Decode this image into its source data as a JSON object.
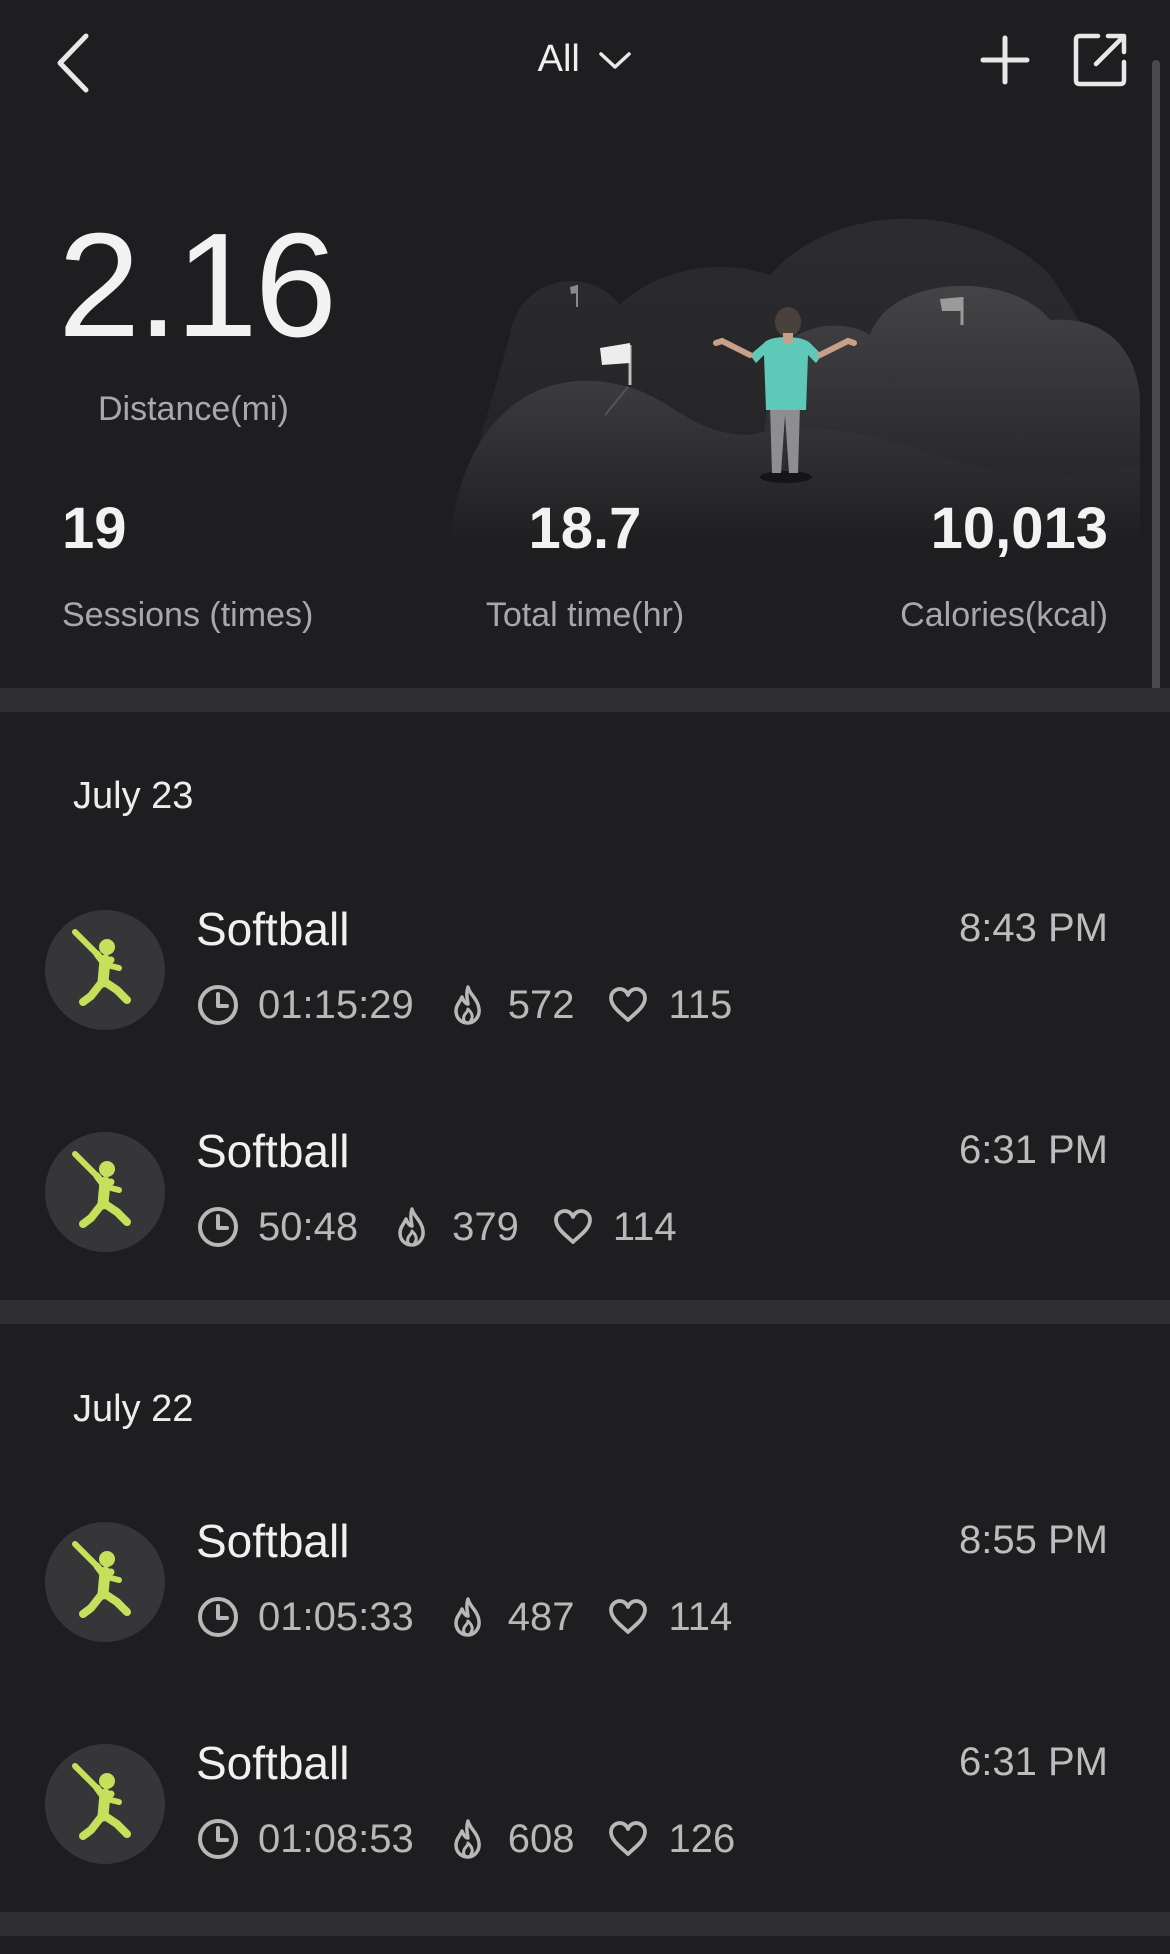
{
  "header": {
    "filter_label": "All"
  },
  "summary": {
    "distance_value": "2.16",
    "distance_label": "Distance(mi)",
    "sessions_value": "19",
    "sessions_label": "Sessions (times)",
    "time_value": "18.7",
    "time_label": "Total time(hr)",
    "calories_value": "10,013",
    "calories_label": "Calories(kcal)"
  },
  "colors": {
    "background": "#1e1e20",
    "divider": "#2f2f31",
    "accent_icon": "#c5e05a",
    "avatar_bg": "#363638",
    "person_shirt": "#5fc9b9"
  },
  "icons": {
    "back": "chevron-left-icon",
    "filter": "chevron-down-icon",
    "add": "plus-icon",
    "share": "share-icon",
    "duration": "clock-icon",
    "calories": "flame-icon",
    "heart_rate": "heart-icon",
    "activity": "softball-player-icon"
  },
  "days": [
    {
      "date": "July 23",
      "sessions": [
        {
          "title": "Softball",
          "time": "8:43 PM",
          "duration": "01:15:29",
          "calories": "572",
          "heart_rate": "115"
        },
        {
          "title": "Softball",
          "time": "6:31 PM",
          "duration": "50:48",
          "calories": "379",
          "heart_rate": "114"
        }
      ]
    },
    {
      "date": "July 22",
      "sessions": [
        {
          "title": "Softball",
          "time": "8:55 PM",
          "duration": "01:05:33",
          "calories": "487",
          "heart_rate": "114"
        },
        {
          "title": "Softball",
          "time": "6:31 PM",
          "duration": "01:08:53",
          "calories": "608",
          "heart_rate": "126"
        }
      ]
    }
  ]
}
